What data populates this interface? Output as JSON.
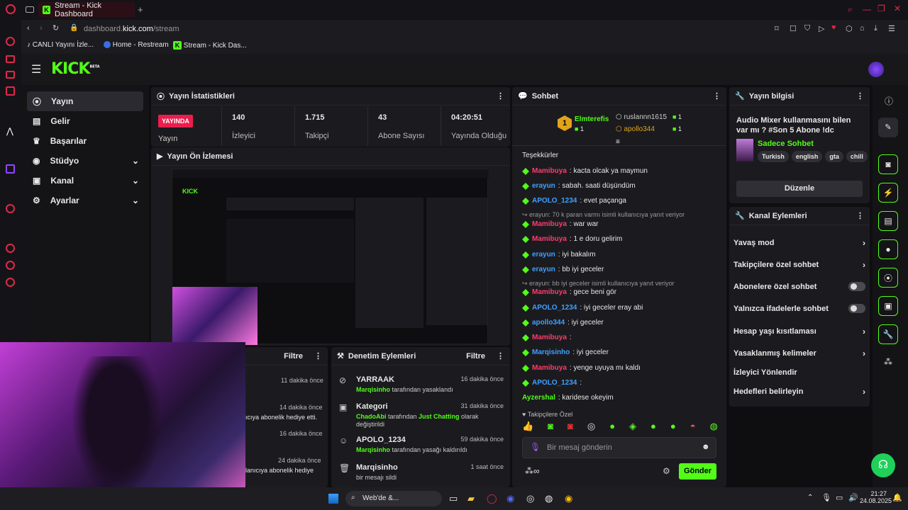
{
  "browser": {
    "tab_title": "Stream - Kick Dashboard",
    "url_domain": "dashboard.",
    "url_host": "kick.com",
    "url_path": "/stream",
    "bookmarks": [
      "CANLI Yayını İzle...",
      "Home - Restream",
      "Stream - Kick Das..."
    ]
  },
  "app": {
    "logo": "KICK",
    "logo_badge": "BETA",
    "nav": [
      {
        "label": "Yayın",
        "icon": "broadcast-icon"
      },
      {
        "label": "Gelir",
        "icon": "chart-icon"
      },
      {
        "label": "Başarılar",
        "icon": "trophy-icon"
      },
      {
        "label": "Stüdyo",
        "icon": "camera-icon"
      },
      {
        "label": "Kanal",
        "icon": "channel-icon"
      },
      {
        "label": "Ayarlar",
        "icon": "gear-icon"
      }
    ]
  },
  "stats": {
    "title": "Yayın İstatistikleri",
    "live_badge": "YAYINDA",
    "live_label": "Yayın",
    "items": [
      {
        "value": "140",
        "label": "İzleyici"
      },
      {
        "value": "1.715",
        "label": "Takipçi"
      },
      {
        "value": "43",
        "label": "Abone Sayısı"
      },
      {
        "value": "04:20:51",
        "label": "Yayında Olduğu"
      }
    ]
  },
  "preview": {
    "title": "Yayın Ön İzlemesi"
  },
  "left_feed": {
    "filter_label": "Filtre",
    "items": [
      {
        "time": "11 dakika önce",
        "text": ""
      },
      {
        "time": "14 dakika önce",
        "text": "ıcıya abonelik hediye etti."
      },
      {
        "time": "16 dakika önce",
        "text": ""
      },
      {
        "time": "24 dakika önce",
        "text": "lanıcıya abonelik hediye"
      }
    ]
  },
  "moderation": {
    "title": "Denetim Eylemleri",
    "filter_label": "Filtre",
    "items": [
      {
        "name": "YARRAAK",
        "by": "Marqisinho",
        "action": " tarafından yasaklandı",
        "time": "16 dakika önce"
      },
      {
        "name": "Kategori",
        "by": "ChadoAbi",
        "action": " tarafından ",
        "extra": "Just Chatting",
        "action2": " olarak",
        "line2": "değiştirildi",
        "time": "31 dakika önce"
      },
      {
        "name": "APOLO_1234",
        "by": "Marqisinho",
        "action": " tarafından yasağı kaldırıldı",
        "time": "59 dakika önce"
      },
      {
        "name": "Marqisinho",
        "action": "bir mesajı sildi",
        "time": "1 saat önce"
      }
    ]
  },
  "chat": {
    "title": "Sohbet",
    "top": [
      {
        "rank": "1",
        "name": "Elmterefis",
        "count": "1"
      },
      {
        "name": "ruslannn1615",
        "count": "1"
      },
      {
        "name": "apollo344",
        "count": "1"
      }
    ],
    "messages": [
      {
        "type": "plain",
        "text": "Teşekkürler"
      },
      {
        "type": "msg",
        "user": "Mamibuya",
        "color": "#ff3b6b",
        "text": ": kacta olcak ya maymun"
      },
      {
        "type": "msg",
        "user": "erayun",
        "color": "#3fa0ff",
        "text": ": sabah. saati düşündüm"
      },
      {
        "type": "msg",
        "user": "APOLO_1234",
        "color": "#3fa0ff",
        "text": ": evet paçanga"
      },
      {
        "type": "reply",
        "text": "↪ erayun: 70 k paran varmı isimli kullanıcıya yanıt veriyor"
      },
      {
        "type": "msg",
        "user": "Mamibuya",
        "color": "#ff3b6b",
        "text": ": war war"
      },
      {
        "type": "msg",
        "user": "Mamibuya",
        "color": "#ff3b6b",
        "text": ": 1 e doru gelirim"
      },
      {
        "type": "msg",
        "user": "erayun",
        "color": "#3fa0ff",
        "text": ": iyi bakalım"
      },
      {
        "type": "msg",
        "user": "erayun",
        "color": "#3fa0ff",
        "text": ": bb iyi geceler"
      },
      {
        "type": "reply",
        "text": "↪ erayun: bb iyi geceler isimli kullanıcıya yanıt veriyor"
      },
      {
        "type": "msg",
        "user": "Mamibuya",
        "color": "#ff3b6b",
        "text": ": gece beni gör"
      },
      {
        "type": "msg",
        "user": "APOLO_1234",
        "color": "#3fa0ff",
        "text": ": iyi geceler eray abi"
      },
      {
        "type": "msg",
        "user": "apollo344",
        "color": "#3fa0ff",
        "text": ": iyi geceler"
      },
      {
        "type": "msg",
        "user": "Mamibuya",
        "color": "#ff3b6b",
        "text": ":"
      },
      {
        "type": "msg",
        "user": "Marqisinho",
        "color": "#3fa0ff",
        "text": ": iyi geceler"
      },
      {
        "type": "msg",
        "user": "Mamibuya",
        "color": "#ff3b6b",
        "text": ": yenge uyuya mı kaldı"
      },
      {
        "type": "msg",
        "user": "APOLO_1234",
        "color": "#3fa0ff",
        "text": ":"
      },
      {
        "type": "msg",
        "user": "Ayzershal",
        "color": "#53fc18",
        "text": ": karidese okeyim"
      }
    ],
    "followers_only": "Takipçilere Özel",
    "input_placeholder": "Bir mesaj gönderin",
    "send_label": "Gönder"
  },
  "stream_info": {
    "title": "Yayın bilgisi",
    "stream_title": "Audio Mixer kullanmasını bilen var mı ? #Son 5 Abone !dc",
    "category": "Sadece Sohbet",
    "tags": [
      "Turkish",
      "english",
      "gta",
      "chill"
    ],
    "edit_label": "Düzenle"
  },
  "channel_actions": {
    "title": "Kanal Eylemleri",
    "items": [
      {
        "label": "Yavaş mod",
        "control": "chevron"
      },
      {
        "label": "Takipçilere özel sohbet",
        "control": "chevron"
      },
      {
        "label": "Abonelere özel sohbet",
        "control": "toggle"
      },
      {
        "label": "Yalnızca ifadelerle sohbet",
        "control": "toggle"
      },
      {
        "label": "Hesap yaşı kısıtlaması",
        "control": "chevron"
      },
      {
        "label": "Yasaklanmış kelimeler",
        "control": "chevron"
      },
      {
        "label": "İzleyici Yönlendir",
        "control": "none"
      },
      {
        "label": "Hedefleri belirleyin",
        "control": "chevron"
      }
    ]
  },
  "taskbar": {
    "search": "Web'de &...",
    "time": "21:27",
    "date": "24.08.2025"
  },
  "colors": {
    "accent": "#53fc18",
    "live": "#e91e4c"
  }
}
